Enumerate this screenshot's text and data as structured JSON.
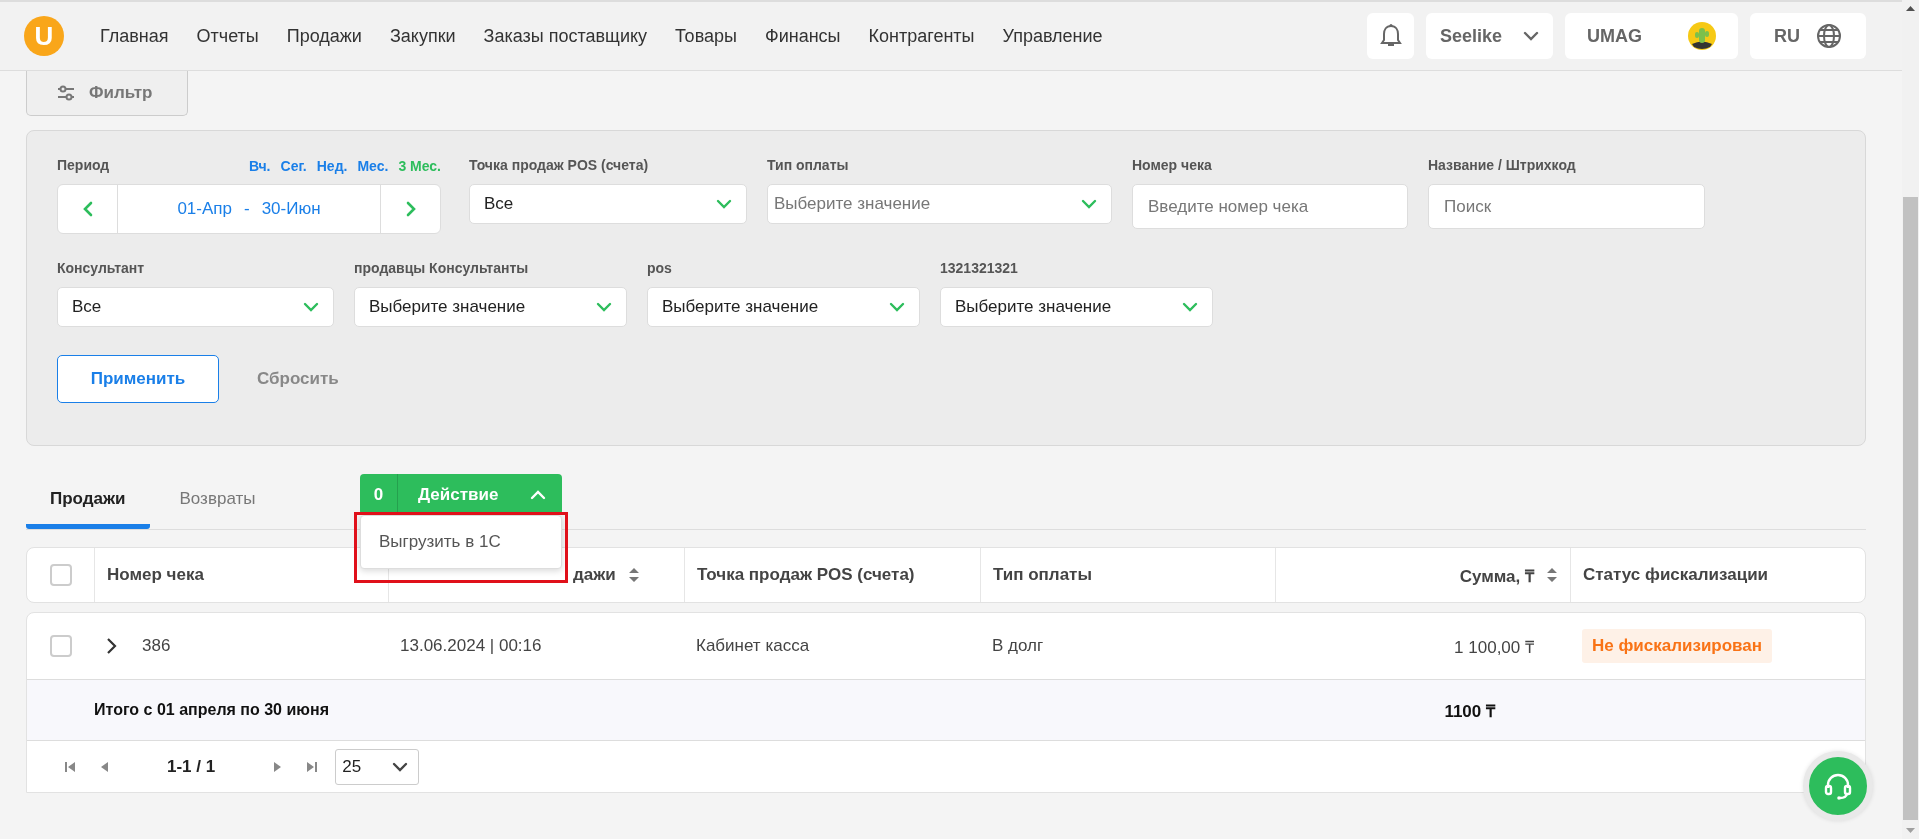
{
  "nav": {
    "logo": "U",
    "items": [
      {
        "label": "Главная"
      },
      {
        "label": "Отчеты"
      },
      {
        "label": "Продажи"
      },
      {
        "label": "Закупки"
      },
      {
        "label": "Заказы поставщику"
      },
      {
        "label": "Товары"
      },
      {
        "label": "Финансы"
      },
      {
        "label": "Контрагенты"
      },
      {
        "label": "Управление"
      }
    ],
    "account": "Seelike",
    "store": "UMAG",
    "language": "RU"
  },
  "filter_button": "Фильтр",
  "filters": {
    "rows": [
      [
        {
          "kind": "period",
          "label": "Период",
          "quick": [
            {
              "label": "Вч.",
              "selected": false
            },
            {
              "label": "Сег.",
              "selected": false
            },
            {
              "label": "Нед.",
              "selected": false
            },
            {
              "label": "Мес.",
              "selected": false
            },
            {
              "label": "3 Мес.",
              "selected": true
            }
          ],
          "range_start": "01-Апр",
          "separator": "-",
          "range_end": "30-Июн"
        },
        {
          "kind": "select",
          "label": "Точка продаж POS (счета)",
          "value": "Все"
        },
        {
          "kind": "select",
          "label": "Тип оплаты",
          "placeholder": "Выберите значение"
        },
        {
          "kind": "input",
          "label": "Номер чека",
          "placeholder": "Введите номер чека"
        },
        {
          "kind": "input",
          "label": "Название / Штрихкод",
          "placeholder": "Поиск"
        }
      ],
      [
        {
          "kind": "select",
          "label": "Консультант",
          "value": "Все"
        },
        {
          "kind": "select",
          "label": "продавцы Консультанты",
          "value": "Выберите значение"
        },
        {
          "kind": "select",
          "label": "pos",
          "value": "Выберите значение"
        },
        {
          "kind": "select",
          "label": "1321321321",
          "value": "Выберите значение"
        }
      ]
    ],
    "apply": "Применить",
    "reset": "Сбросить"
  },
  "tabs": [
    {
      "label": "Продажи",
      "selected": true
    },
    {
      "label": "Возвраты",
      "selected": false
    }
  ],
  "action": {
    "count": "0",
    "label": "Действие",
    "expanded": true,
    "menu": [
      {
        "label": "Выгрузить в 1С",
        "highlighted": true
      }
    ]
  },
  "table": {
    "all_checked": false,
    "columns": [
      {
        "label": "Номер чека",
        "sortable": false
      },
      {
        "label": "дажи",
        "sortable": true
      },
      {
        "label": "Точка продаж POS (счета)",
        "sortable": false
      },
      {
        "label": "Тип оплаты",
        "sortable": false
      },
      {
        "label": "Сумма, ₸",
        "sortable": true
      },
      {
        "label": "Статус фискализации",
        "sortable": false
      }
    ],
    "rows": [
      {
        "checked": false,
        "expanded": false,
        "cells": [
          "386",
          "13.06.2024 | 00:16",
          "Кабинет касса",
          "В долг",
          "1 100,00 ₸"
        ],
        "status": {
          "label": "Не фискализирован",
          "color": "#f97316"
        }
      }
    ],
    "total": {
      "label": "Итого с 01 апреля по 30 июня",
      "sum": "1100 ₸"
    }
  },
  "pagination": {
    "range": "1-1 / 1",
    "page_size": "25"
  }
}
